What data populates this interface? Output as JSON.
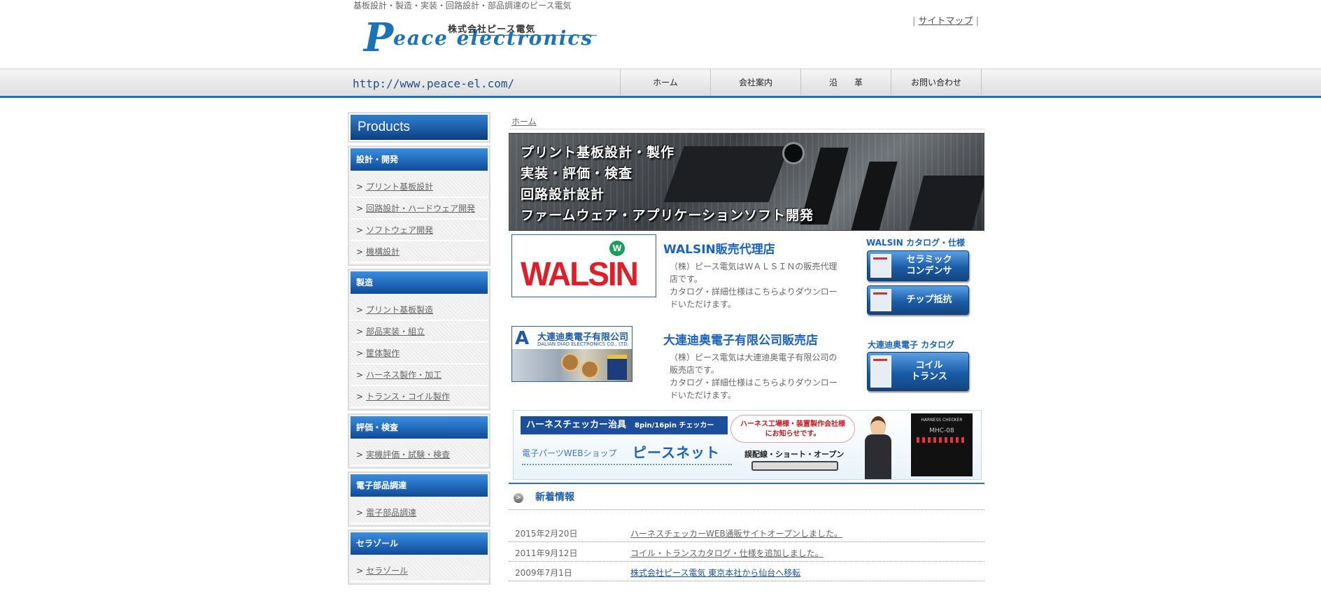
{
  "header": {
    "tagline": "基板設計・製造・実装・回路設計・部品調達のピース電気",
    "logo_corp": "株式会社ピース電気",
    "logo_brand_p": "P",
    "logo_brand_rest": "eace  electronics",
    "sitemap_pre": "|",
    "sitemap_label": "サイトマップ",
    "sitemap_post": "|"
  },
  "nav": {
    "url": "http://www.peace-el.com/",
    "items": [
      {
        "label": "ホーム"
      },
      {
        "label": "会社案内"
      },
      {
        "label": "沿　　革"
      },
      {
        "label": "お問い合わせ"
      }
    ]
  },
  "sidebar": {
    "title": "Products",
    "categories": [
      {
        "title": "設計・開発",
        "items": [
          {
            "label": "プリント基板設計"
          },
          {
            "label": "回路設計・ハードウェア開発"
          },
          {
            "label": "ソフトウェア開発"
          },
          {
            "label": "機構設計"
          }
        ]
      },
      {
        "title": "製造",
        "items": [
          {
            "label": "プリント基板製造"
          },
          {
            "label": "部品実装・組立"
          },
          {
            "label": "筐体製作"
          },
          {
            "label": "ハーネス製作・加工"
          },
          {
            "label": "トランス・コイル製作"
          }
        ]
      },
      {
        "title": "評価・検査",
        "items": [
          {
            "label": "実機評価・試験・検査"
          }
        ]
      },
      {
        "title": "電子部品調達",
        "items": [
          {
            "label": "電子部品調達"
          }
        ]
      },
      {
        "title": "セラゾール",
        "items": [
          {
            "label": "セラゾール"
          }
        ]
      }
    ]
  },
  "breadcrumb": "ホーム",
  "hero": {
    "lines": [
      "プリント基板設計・製作",
      "実装・評価・検査",
      "回路設計設計",
      "ファームウェア・アプリケーションソフト開発"
    ]
  },
  "walsin": {
    "logo_text": "WALSIN",
    "logo_badge": "W",
    "title": "WALSIN販売代理店",
    "desc1": "（株）ピース電気はＷＡＬＳＩＮの販売代理店です。",
    "desc2": "カタログ・詳細仕様はこちらよりダウンロードいただけます。",
    "catalog_label": "WALSIN カタログ・仕様",
    "btn1": "セラミック\nコンデンサ",
    "btn2": "チップ抵抗"
  },
  "dalian": {
    "logo_title": "大連迪奥電子有限公司",
    "logo_sub": "DALIAN DIAO ELECTRONICS CO., LTD.",
    "title": "大連迪奥電子有限公司販売店",
    "desc1": "（株）ピース電気は大連迪奥電子有限公司の販売店です。",
    "desc2": "カタログ・詳細仕様はこちらよりダウンロードいただけます。",
    "catalog_label": "大連迪奥電子 カタログ",
    "btn1": "コイル\nトランス"
  },
  "banner": {
    "title": "ハーネスチェッカー治具",
    "title_sub": "8pin/16pin チェッカー",
    "shop_label": "電子パーツWEBショップ",
    "shop_name": "ピースネット",
    "bubble1": "ハーネス工場様・装置製作会社様",
    "bubble2": "にお知らせです。",
    "wire_text": "誤配線・ショート・オープン",
    "device_label": "HARNESS CHECKER",
    "device_model": "MHC-08"
  },
  "news": {
    "title": "新着情報",
    "items": [
      {
        "date": "2015年2月20日",
        "text": "ハーネスチェッカーWEB通販サイトオープンしました。"
      },
      {
        "date": "2011年9月12日",
        "text": "コイル・トランスカタログ・仕様を追加しました。"
      },
      {
        "date": "2009年7月1日",
        "text": "株式会社ピース電気 東京本社から仙台へ移転"
      }
    ]
  },
  "colors": {
    "accent": "#1a6fc0",
    "nav_bg": "#dcdcdc",
    "brand_red": "#e01e28"
  },
  "icons": {
    "news_bullet": "chevron-right-icon",
    "menu_arrow": "angle-right-icon"
  }
}
